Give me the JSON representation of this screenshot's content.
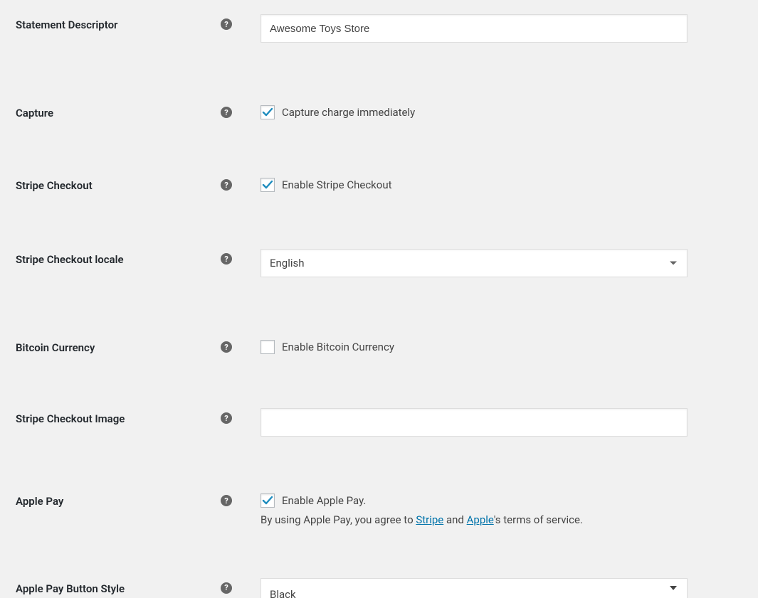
{
  "fields": {
    "statement_descriptor": {
      "label": "Statement Descriptor",
      "value": "Awesome Toys Store"
    },
    "capture": {
      "label": "Capture",
      "checkbox_label": "Capture charge immediately",
      "checked": true
    },
    "stripe_checkout": {
      "label": "Stripe Checkout",
      "checkbox_label": "Enable Stripe Checkout",
      "checked": true
    },
    "stripe_checkout_locale": {
      "label": "Stripe Checkout locale",
      "value": "English"
    },
    "bitcoin_currency": {
      "label": "Bitcoin Currency",
      "checkbox_label": "Enable Bitcoin Currency",
      "checked": false
    },
    "stripe_checkout_image": {
      "label": "Stripe Checkout Image",
      "value": ""
    },
    "apple_pay": {
      "label": "Apple Pay",
      "checkbox_label": "Enable Apple Pay.",
      "checked": true,
      "desc_pre": "By using Apple Pay, you agree to ",
      "link1": "Stripe",
      "desc_mid": " and ",
      "link2": "Apple",
      "desc_post": "'s terms of service."
    },
    "apple_pay_button_style": {
      "label": "Apple Pay Button Style",
      "value": "Black"
    }
  }
}
